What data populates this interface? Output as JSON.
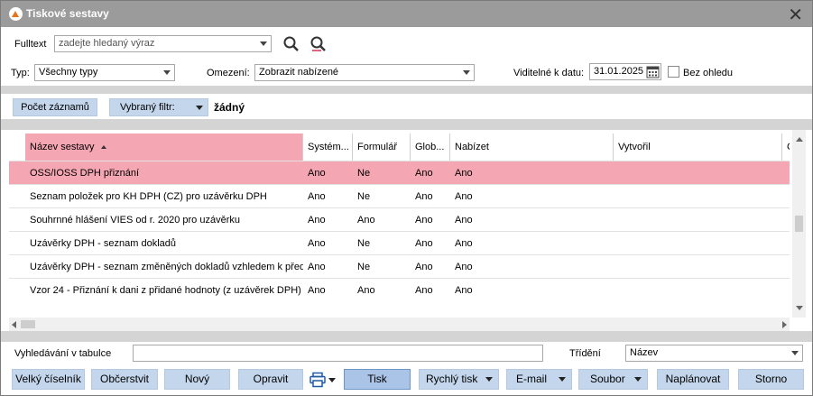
{
  "window": {
    "title": "Tiskové sestavy"
  },
  "filters": {
    "fulltext_label": "Fulltext",
    "fulltext_placeholder": "zadejte hledaný výraz",
    "typ_label": "Typ:",
    "typ_value": "Všechny typy",
    "omezeni_label": "Omezení:",
    "omezeni_value": "Zobrazit nabízené",
    "date_label": "Viditelné k datu:",
    "date_value": "31.01.2025",
    "bez_ohledu_label": "Bez ohledu"
  },
  "toolbar": {
    "count_button": "Počet záznamů",
    "filter_button": "Vybraný filtr:",
    "filter_value": "žádný"
  },
  "table": {
    "columns": [
      "Název sestavy",
      "Systém...",
      "Formulář",
      "Glob...",
      "Nabízet",
      "Vytvořil",
      "C"
    ],
    "rows": [
      [
        "OSS/IOSS DPH přiznání",
        "Ano",
        "Ne",
        "Ano",
        "Ano"
      ],
      [
        "Seznam položek pro KH DPH (CZ) pro uzávěrku DPH",
        "Ano",
        "Ne",
        "Ano",
        "Ano"
      ],
      [
        "Souhrnné hlášení VIES od r. 2020 pro uzávěrku",
        "Ano",
        "Ano",
        "Ano",
        "Ano"
      ],
      [
        "Uzávěrky DPH - seznam dokladů",
        "Ano",
        "Ne",
        "Ano",
        "Ano"
      ],
      [
        "Uzávěrky DPH - seznam změněných dokladů vzhledem k předc",
        "Ano",
        "Ne",
        "Ano",
        "Ano"
      ],
      [
        "Vzor 24 - Přiznání k dani z přidané hodnoty (z uzávěrek DPH)",
        "Ano",
        "Ano",
        "Ano",
        "Ano"
      ]
    ]
  },
  "bottom": {
    "search_label": "Vyhledávání v tabulce",
    "sort_label": "Třídění",
    "sort_value": "Název"
  },
  "buttons": {
    "velky_ciselnik": "Velký číselník",
    "obcerstvit": "Občerstvit",
    "novy": "Nový",
    "opravit": "Opravit",
    "tisk": "Tisk",
    "rychly_tisk": "Rychlý tisk",
    "email": "E-mail",
    "soubor": "Soubor",
    "naplanovat": "Naplánovat",
    "storno": "Storno"
  },
  "colors": {
    "selected_row": "#f5a6b3",
    "button": "#c4d6ec",
    "titlebar": "#9b9b9b",
    "accent_logo": "#e8731c"
  }
}
